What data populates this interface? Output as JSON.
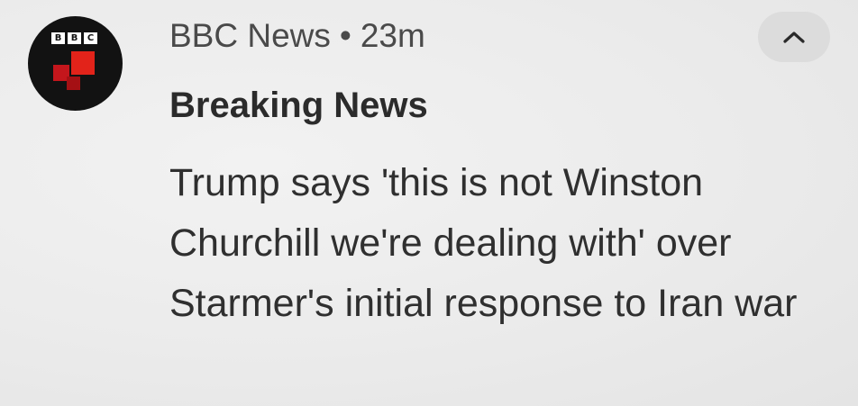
{
  "notification": {
    "app_name": "BBC News",
    "separator": "•",
    "time": "23m",
    "title": "Breaking News",
    "body": "Trump says 'this is not Winston Churchill we're dealing with' over Starmer's initial response to Iran war",
    "app_icon": {
      "name": "bbc-news-icon",
      "letters": [
        "B",
        "B",
        "C"
      ],
      "colors": {
        "background": "#121212",
        "accent": "#e2231a"
      }
    },
    "expand_icon": "chevron-up-icon"
  }
}
